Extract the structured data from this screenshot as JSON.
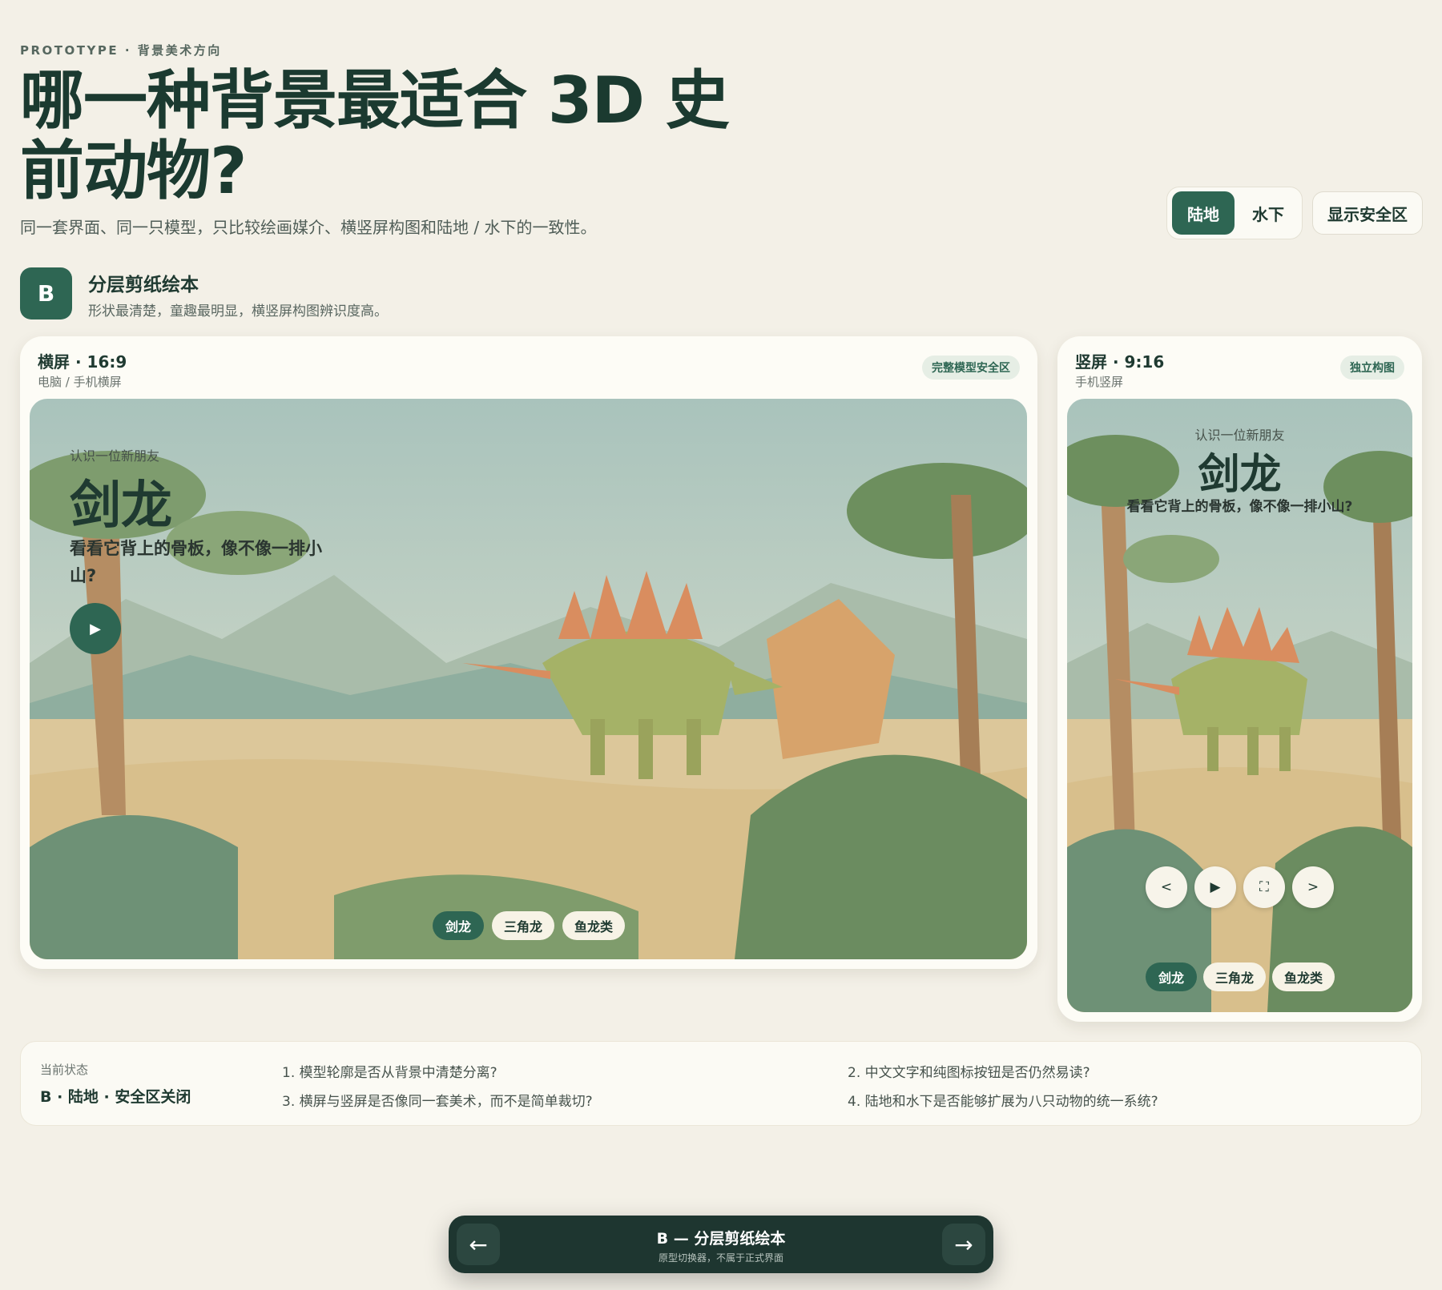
{
  "header": {
    "eyebrow": "PROTOTYPE · 背景美术方向",
    "title": "哪一种背景最适合 3D 史前动物?",
    "subtitle": "同一套界面、同一只模型，只比较绘画媒介、横竖屏构图和陆地 / 水下的一致性。"
  },
  "controls": {
    "env_tabs": [
      "陆地",
      "水下"
    ],
    "safe_zone_label": "显示安全区"
  },
  "variant": {
    "badge": "B",
    "name": "分层剪纸绘本",
    "desc": "形状最清楚，童趣最明显，横竖屏构图辨识度高。"
  },
  "landscape": {
    "title": "横屏 · 16:9",
    "sub": "电脑 / 手机横屏",
    "chip": "完整模型安全区",
    "kicker": "认识一位新朋友",
    "dino": "剑龙",
    "question": "看看它背上的骨板，像不像一排小山?",
    "animals": [
      "剑龙",
      "三角龙",
      "鱼龙类"
    ]
  },
  "portrait": {
    "title": "竖屏 · 9:16",
    "sub": "手机竖屏",
    "chip": "独立构图",
    "kicker": "认识一位新朋友",
    "dino": "剑龙",
    "question": "看看它背上的骨板，像不像一排小山?",
    "animals": [
      "剑龙",
      "三角龙",
      "鱼龙类"
    ]
  },
  "status": {
    "label": "当前状态",
    "value": "B · 陆地 · 安全区关闭",
    "questions": [
      "1. 模型轮廓是否从背景中清楚分离?",
      "2. 中文文字和纯图标按钮是否仍然易读?",
      "3. 横屏与竖屏是否像同一套美术，而不是简单裁切?",
      "4. 陆地和水下是否能够扩展为八只动物的统一系统?"
    ]
  },
  "switcher": {
    "title": "B — 分层剪纸绘本",
    "sub": "原型切换器，不属于正式界面"
  }
}
